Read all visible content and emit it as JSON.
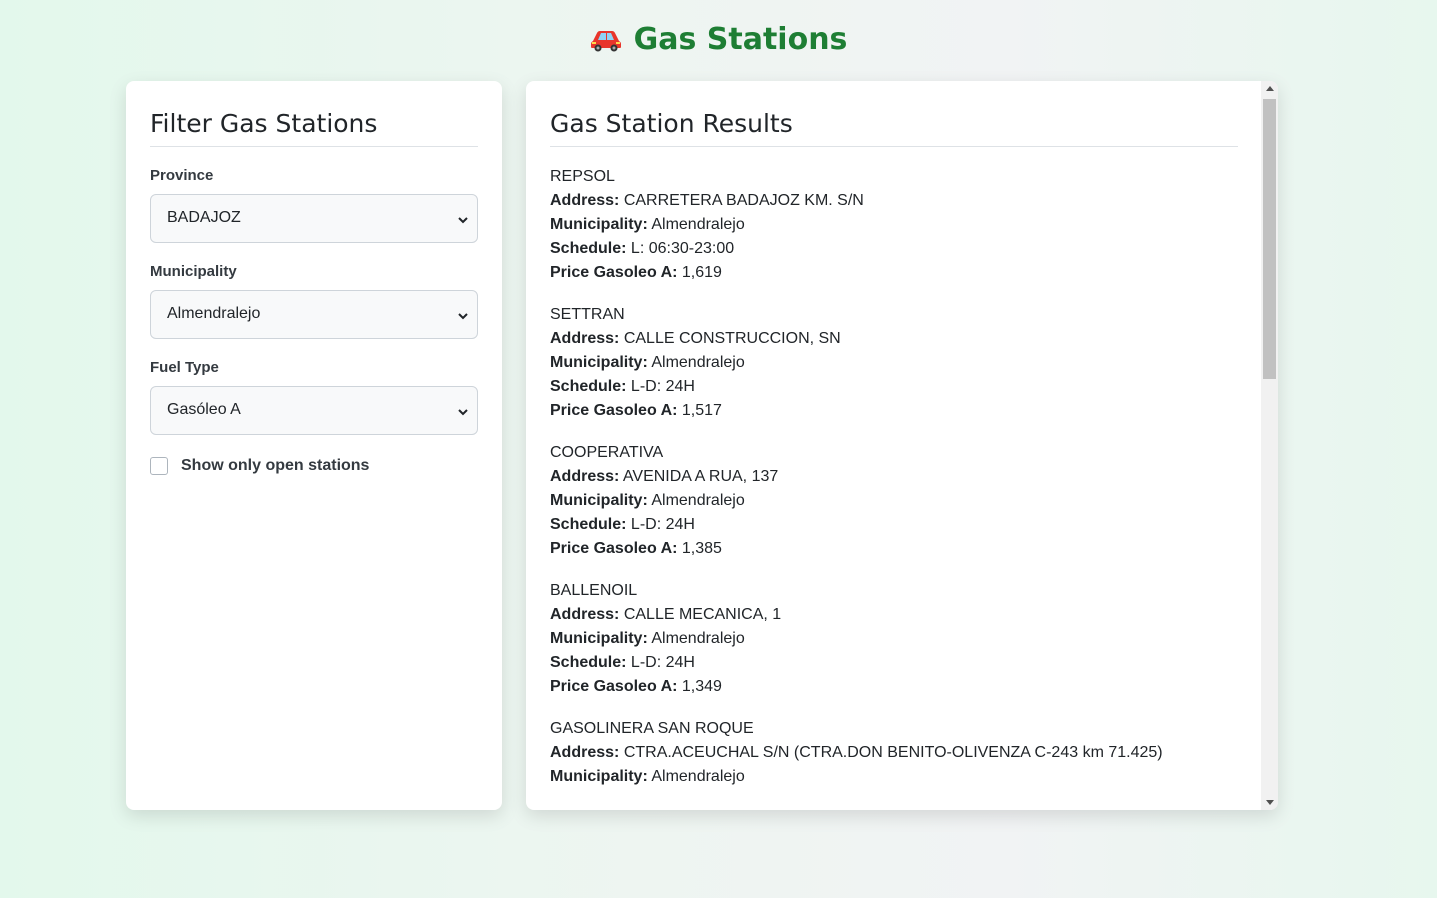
{
  "app": {
    "title": "Gas Stations"
  },
  "filters": {
    "heading": "Filter Gas Stations",
    "province": {
      "label": "Province",
      "value": "BADAJOZ"
    },
    "municipality": {
      "label": "Municipality",
      "value": "Almendralejo"
    },
    "fuel_type": {
      "label": "Fuel Type",
      "value": "Gasóleo A"
    },
    "open_only": {
      "label": "Show only open stations",
      "checked": false
    }
  },
  "results": {
    "heading": "Gas Station Results",
    "field_labels": {
      "address": "Address:",
      "municipality": "Municipality:",
      "schedule": "Schedule:",
      "price": "Price Gasoleo A:"
    },
    "stations": [
      {
        "name": "REPSOL",
        "address": "CARRETERA BADAJOZ KM. S/N",
        "municipality": "Almendralejo",
        "schedule": "L: 06:30-23:00",
        "price": "1,619"
      },
      {
        "name": "SETTRAN",
        "address": "CALLE CONSTRUCCION, SN",
        "municipality": "Almendralejo",
        "schedule": "L-D: 24H",
        "price": "1,517"
      },
      {
        "name": "COOPERATIVA",
        "address": "AVENIDA A RUA, 137",
        "municipality": "Almendralejo",
        "schedule": "L-D: 24H",
        "price": "1,385"
      },
      {
        "name": "BALLENOIL",
        "address": "CALLE MECANICA, 1",
        "municipality": "Almendralejo",
        "schedule": "L-D: 24H",
        "price": "1,349"
      },
      {
        "name": "GASOLINERA SAN ROQUE",
        "address": "CTRA.ACEUCHAL S/N (CTRA.DON BENITO-OLIVENZA C-243 km 71.425)",
        "municipality": "Almendralejo"
      }
    ]
  }
}
